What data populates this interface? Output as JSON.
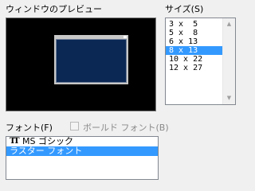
{
  "preview": {
    "label": "ウィンドウのプレビュー"
  },
  "size": {
    "label": "サイズ(S)",
    "items": [
      "3 x  5",
      "5 x  8",
      "6 x 13",
      "8 x 13",
      "10 x 22",
      "12 x 27"
    ],
    "selected_index": 3
  },
  "font": {
    "label": "フォント(F)",
    "bold_label": "ボールド フォント(B)",
    "bold_checked": false,
    "bold_enabled": false,
    "items": [
      {
        "icon": "truetype-icon",
        "icon_text": "TT",
        "label": "MS ゴシック"
      },
      {
        "icon": null,
        "label": "ラスター フォント"
      }
    ],
    "selected_index": 1
  },
  "colors": {
    "selection": "#3399ff",
    "preview_bg": "#000000",
    "console_bg": "#0b2855"
  }
}
